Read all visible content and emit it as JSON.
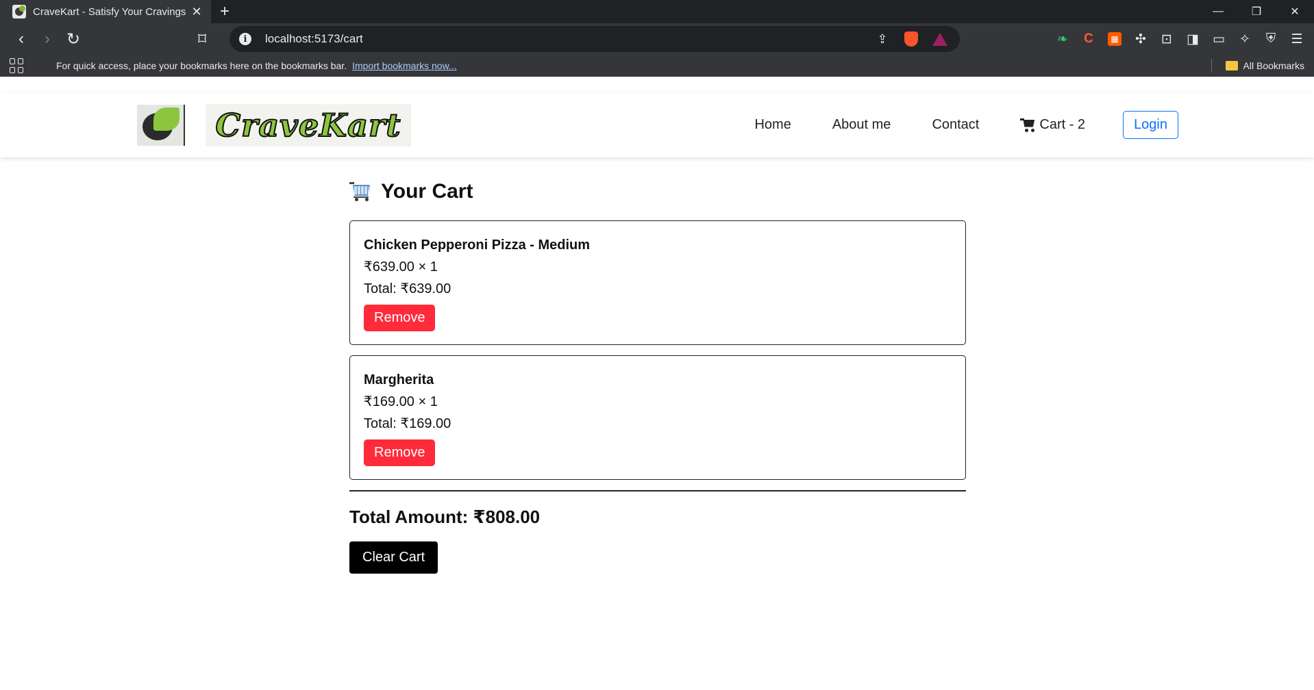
{
  "browser": {
    "tab_title": "CraveKart - Satisfy Your Cravings",
    "tab_close": "✕",
    "new_tab": "+",
    "url": "localhost:5173/cart",
    "bookmarks_message": "For quick access, place your bookmarks here on the bookmarks bar.",
    "import_link": "Import bookmarks now...",
    "all_bookmarks": "All Bookmarks"
  },
  "navbar": {
    "logo_text": "CraveKart",
    "links": [
      "Home",
      "About me",
      "Contact"
    ],
    "cart_label": "Cart - 2",
    "login_label": "Login"
  },
  "cart": {
    "title": "Your Cart",
    "items": [
      {
        "name": "Chicken Pepperoni Pizza - Medium",
        "price_qty": "₹639.00 × 1",
        "total": "Total: ₹639.00",
        "remove_label": "Remove"
      },
      {
        "name": "Margherita",
        "price_qty": "₹169.00 × 1",
        "total": "Total: ₹169.00",
        "remove_label": "Remove"
      }
    ],
    "total_amount": "Total Amount: ₹808.00",
    "clear_label": "Clear Cart"
  },
  "colors": {
    "accent_blue": "#0d6efd",
    "remove_red": "#ff2b3a",
    "logo_green": "#8cc63f",
    "chrome_dark": "#35363a"
  }
}
